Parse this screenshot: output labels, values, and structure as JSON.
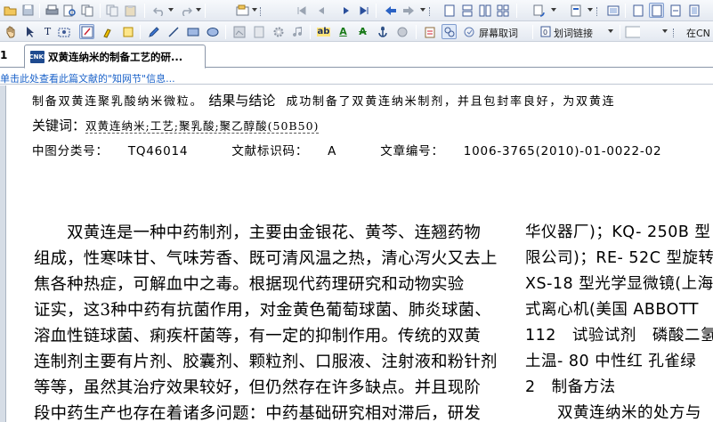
{
  "toolbar2": {
    "screen_word_label": "屏幕取词",
    "word_link_label": "划词链接",
    "search_prefix": "在CN"
  },
  "tabs": {
    "left_marker": "1",
    "doc_icon_text": "CNKI",
    "active_title": "双黄连纳米的制备工艺的研..."
  },
  "infobar": {
    "text": "单击此处查看此篇文献的\"知网节\"信息..."
  },
  "document": {
    "abstract_prefix": "制备双黄连聚乳酸纳米微粒。",
    "results_heading": "结果与结论",
    "abstract_suffix": "成功制备了双黄连纳米制剂，并且包封率良好，为双黄连",
    "keywords_label": "关键词：",
    "keywords": "双黄连纳米;工艺;聚乳酸;聚乙醇酸(50B50)",
    "clc_label": "中图分类号：",
    "clc_value": "TQ46014",
    "doc_id_label": "文献标识码：",
    "doc_id_value": "A",
    "article_no_label": "文章编号：",
    "article_no_value": "1006-3765(2010)-01-0022-02",
    "col1_lines": [
      "　　双黄连是一种中药制剂，主要由金银花、黄芩、连翘药物",
      "组成，性寒味甘、气味芳香、既可清风温之热，清心泻火又去上",
      "焦各种热症，可解血中之毒。根据现代药理研究和动物实验",
      "证实，这3种中药有抗菌作用，对金黄色葡萄球菌、肺炎球菌、",
      "溶血性链球菌、痢疾杆菌等，有一定的抑制作用。传统的双黄",
      "连制剂主要有片剂、胶囊剂、颗粒剂、口服液、注射液和粉针剂",
      "等等，虽然其治疗效果较好，但仍然存在许多缺点。并且现阶",
      "段中药生产也存在着诸多问题：中药基础研究相对滞后，研发"
    ],
    "col2_lines": [
      "华仪器厂)；KQ- 250B 型",
      "限公司)；RE- 52C 型旋转",
      "XS-18 型光学显微镜(上海",
      "式离心机(美国 ABBOTT",
      "112　试验试剂　磷酸二氢",
      "土温- 80 中性红 孔雀绿",
      "2　制备方法",
      "　　双黄连纳米的处方与"
    ]
  }
}
